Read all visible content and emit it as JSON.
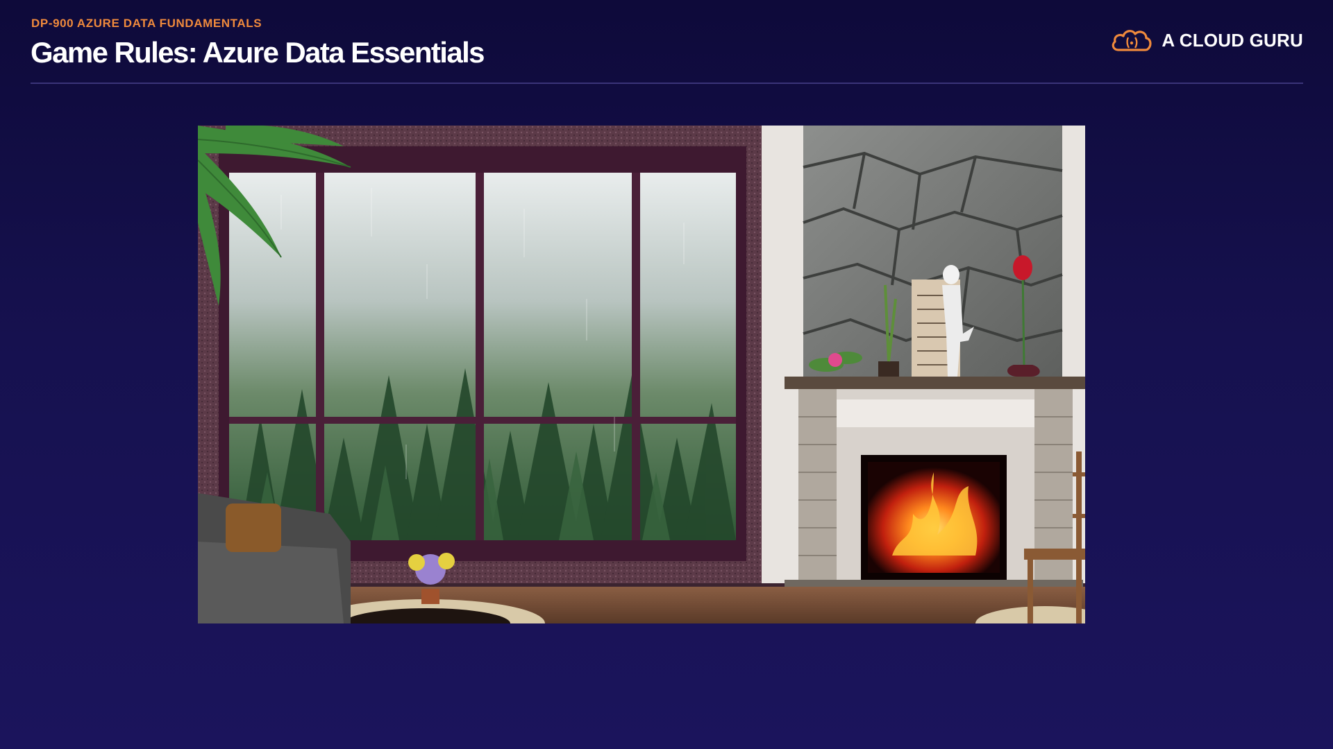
{
  "header": {
    "eyebrow": "DP-900 AZURE DATA FUNDAMENTALS",
    "title": "Game Rules: Azure Data Essentials"
  },
  "brand": {
    "name": "A CLOUD GURU",
    "icon": "cloud-logo-icon",
    "accent_color": "#f08a3c"
  },
  "colors": {
    "background": "#14104a",
    "eyebrow": "#f08a3c",
    "title": "#ffffff",
    "divider": "#3a3479"
  },
  "scene": {
    "icon": "cozy-room-illustration"
  }
}
